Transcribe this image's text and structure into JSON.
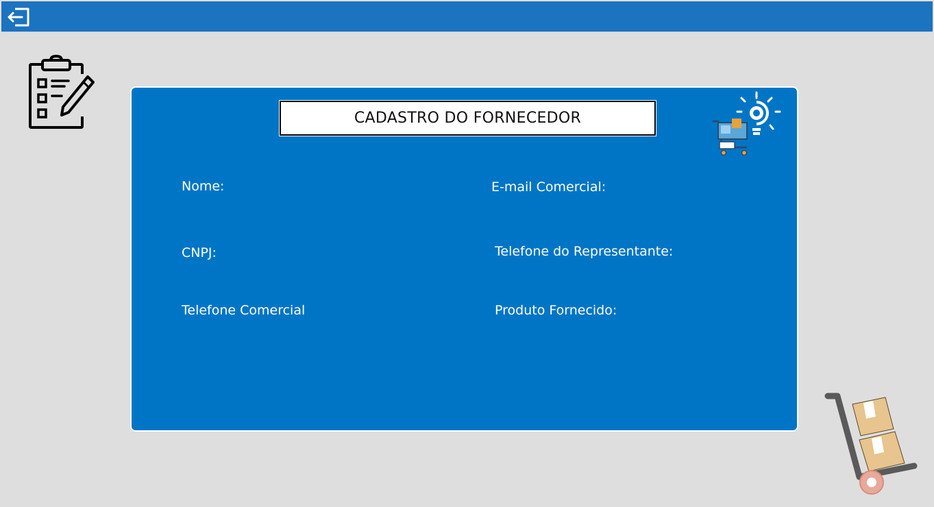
{
  "header": {
    "exit_icon": "exit-icon",
    "bar_color": "#1c73bf"
  },
  "decor": {
    "clipboard_icon": "clipboard-checklist-icon",
    "shop_icon": "shopping-cart-bulb-icon",
    "trolley_icon": "hand-truck-boxes-icon"
  },
  "form": {
    "title": "CADASTRO DO FORNECEDOR",
    "card_color": "#0075c6",
    "labels": {
      "nome": "Nome:",
      "email": "E-mail Comercial:",
      "cnpj": "CNPJ:",
      "telefone_representante": "Telefone do Representante:",
      "telefone_comercial": "Telefone Comercial",
      "produto": "Produto Fornecido:"
    }
  }
}
